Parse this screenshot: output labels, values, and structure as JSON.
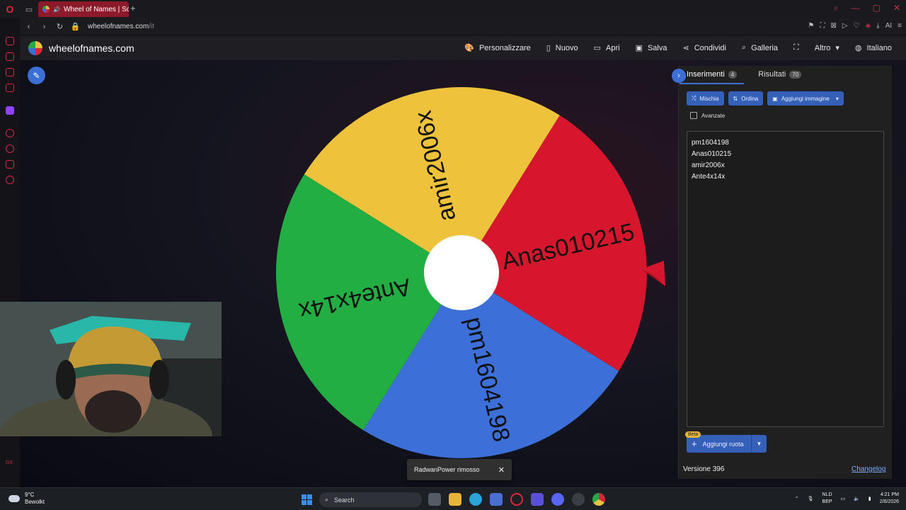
{
  "browser": {
    "tab_title": "Wheel of Names | Scel",
    "url_main": "wheelofnames.com",
    "url_path": "/it"
  },
  "site": {
    "title": "wheelofnames.com",
    "menu": [
      "Personalizzare",
      "Nuovo",
      "Apri",
      "Salva",
      "Condividi",
      "Galleria",
      "Altro",
      "Italiano"
    ]
  },
  "wheel": {
    "entries": [
      "pm1604198",
      "Anas010215",
      "amir2006x",
      "Ante4x14x"
    ],
    "colors": {
      "yellow": "#EFC23B",
      "red": "#D6162D",
      "blue": "#3D6FD8",
      "green": "#23AE43"
    }
  },
  "panel": {
    "tabs": [
      {
        "label": "Inserimenti",
        "count": "4"
      },
      {
        "label": "Risultati",
        "count": "70"
      }
    ],
    "buttons": [
      "Mischia",
      "Ordina",
      "Aggiungi immagine"
    ],
    "advanced_label": "Avanzate",
    "beta_label": "Beta",
    "add_wheel_label": "Aggiungi ruota",
    "version": "Versione 396",
    "changelog": "Changelog"
  },
  "toast": {
    "message": "RadwanPower rimosso"
  },
  "taskbar": {
    "weather_temp": "9°C",
    "weather_desc": "Bewolkt",
    "search_placeholder": "Search",
    "lang_top": "NLD",
    "lang_bottom": "BEP",
    "time": "4:21 PM",
    "date": "2/6/2026"
  }
}
